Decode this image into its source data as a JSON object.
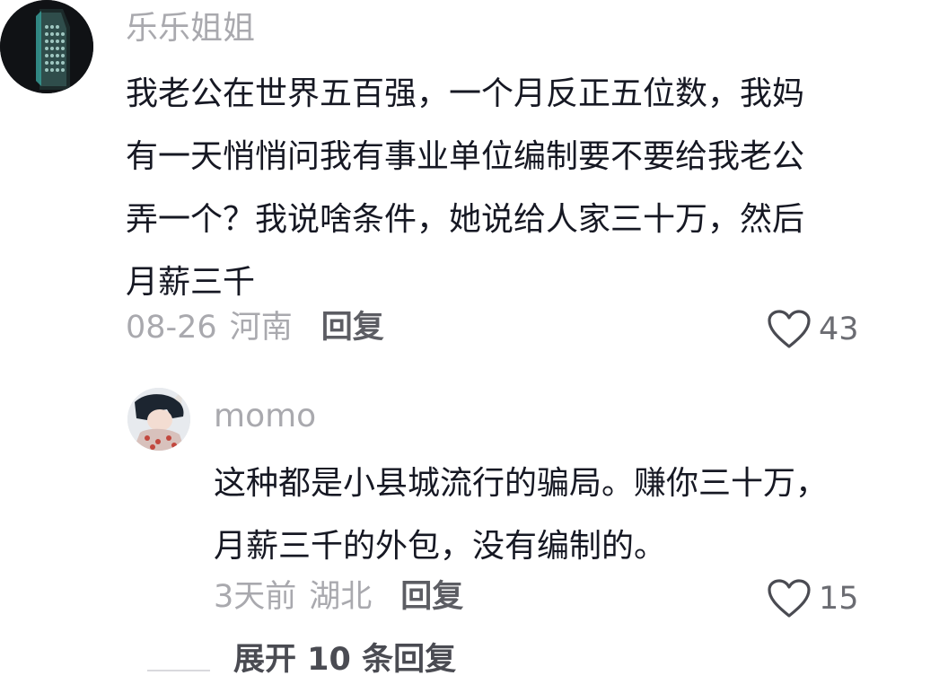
{
  "comment": {
    "username": "乐乐姐姐",
    "text_lines": [
      "我老公在世界五百强，一个月反正五位数，我妈",
      "有一天悄悄问我有事业单位编制要不要给我老公",
      "弄一个？我说啥条件，她说给人家三十万，然后",
      "月薪三千"
    ],
    "date": "08-26",
    "region": "河南",
    "reply_label": "回复",
    "like_count": "43",
    "like_icon": "heart-outline-icon"
  },
  "reply": {
    "username": "momo",
    "text_lines": [
      "这种都是小县城流行的骗局。赚你三十万，",
      "月薪三千的外包，没有编制的。"
    ],
    "date": "3天前",
    "region": "湖北",
    "reply_label": "回复",
    "like_count": "15",
    "like_icon": "heart-outline-icon"
  },
  "expand_replies_label": "展开 10 条回复",
  "colors": {
    "text": "#161823",
    "muted": "#a9a9ae",
    "action": "#5c5d63"
  }
}
